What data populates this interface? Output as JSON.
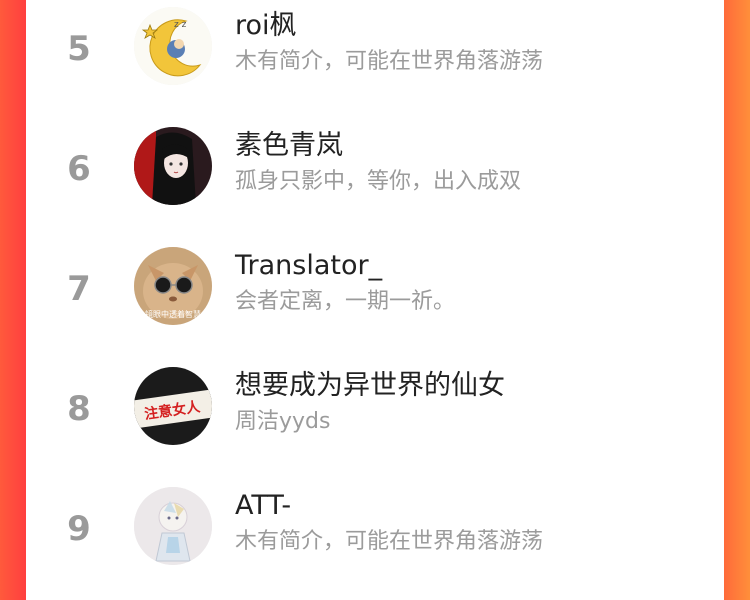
{
  "ranking": {
    "items": [
      {
        "rank": "5",
        "name": "roi枫",
        "bio": "木有简介，可能在世界角落游荡",
        "avatar_icon": "moon-sleeping-avatar-icon"
      },
      {
        "rank": "6",
        "name": "素色青岚",
        "bio": "孤身只影中，等你，出入成双",
        "avatar_icon": "anime-girl-avatar-icon"
      },
      {
        "rank": "7",
        "name": "Translator_",
        "bio": "会者定离，一期一祈。",
        "avatar_icon": "cat-sunglasses-avatar-icon",
        "avatar_caption": "镜眼中透着智慧"
      },
      {
        "rank": "8",
        "name": "想要成为异世界的仙女",
        "bio": "周洁yyds",
        "avatar_icon": "banner-text-avatar-icon",
        "avatar_caption": "注意女人"
      },
      {
        "rank": "9",
        "name": "ATT-",
        "bio": "木有简介，可能在世界角落游荡",
        "avatar_icon": "crystal-figure-avatar-icon"
      }
    ]
  }
}
